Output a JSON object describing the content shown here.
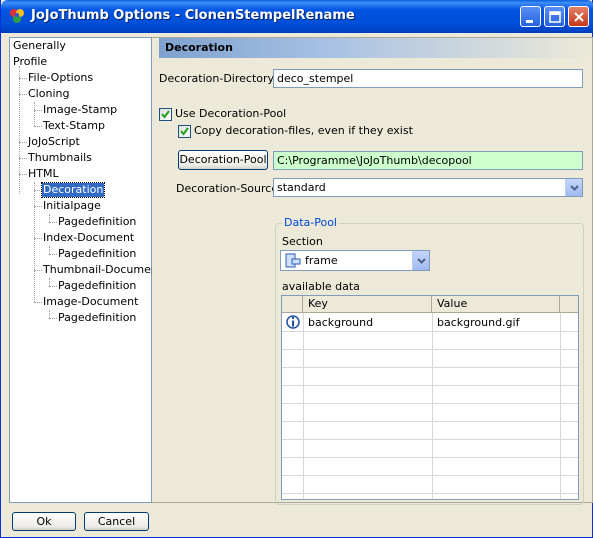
{
  "window": {
    "title": "JoJoThumb Options - ClonenStempelRename"
  },
  "tree": {
    "items": [
      {
        "label": "Generally",
        "selected": false
      },
      {
        "label": "Profile",
        "selected": false
      },
      {
        "label": "File-Options",
        "selected": false
      },
      {
        "label": "Cloning",
        "selected": false
      },
      {
        "label": "Image-Stamp",
        "selected": false
      },
      {
        "label": "Text-Stamp",
        "selected": false
      },
      {
        "label": "JoJoScript",
        "selected": false
      },
      {
        "label": "Thumbnails",
        "selected": false
      },
      {
        "label": "HTML",
        "selected": false
      },
      {
        "label": "Decoration",
        "selected": true
      },
      {
        "label": "Initialpage",
        "selected": false
      },
      {
        "label": "Pagedefinition",
        "selected": false
      },
      {
        "label": "Index-Document",
        "selected": false
      },
      {
        "label": "Pagedefinition",
        "selected": false
      },
      {
        "label": "Thumbnail-Document",
        "selected": false
      },
      {
        "label": "Pagedefinition",
        "selected": false
      },
      {
        "label": "Image-Document",
        "selected": false
      },
      {
        "label": "Pagedefinition",
        "selected": false
      }
    ]
  },
  "footer": {
    "ok_label": "Ok",
    "cancel_label": "Cancel"
  },
  "decoration": {
    "header": "Decoration",
    "directory_label": "Decoration-Directory",
    "directory_value": "deco_stempel",
    "use_pool_label": "Use Decoration-Pool",
    "use_pool_checked": true,
    "copy_files_label": "Copy decoration-files, even if they exist",
    "copy_files_checked": true,
    "pool_button_label": "Decoration-Pool",
    "pool_path": "C:\\Programme\\JoJoThumb\\decopool",
    "source_label": "Decoration-Source",
    "source_value": "standard",
    "data_pool": {
      "title": "Data-Pool",
      "section_label": "Section",
      "section_value": "frame",
      "available_label": "available data",
      "columns": [
        "Key",
        "Value"
      ],
      "rows": [
        {
          "key": "background",
          "value": "background.gif"
        }
      ]
    }
  },
  "colors": {
    "accent": "#316ac5",
    "pool_path_bg": "#ccffcc",
    "group_title": "#0046d5"
  }
}
